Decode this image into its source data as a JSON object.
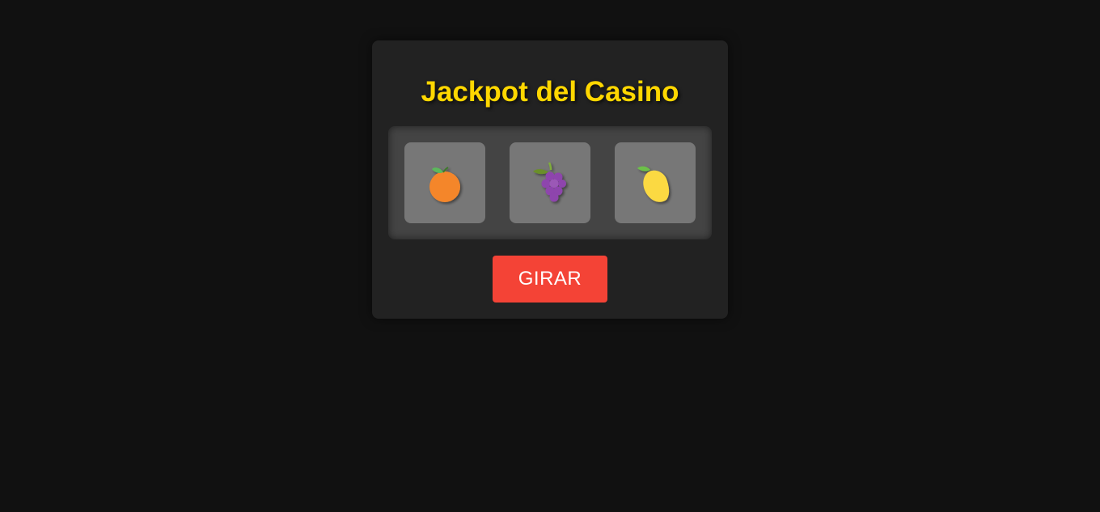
{
  "game": {
    "title": "Jackpot del Casino",
    "spin_label": "GIRAR"
  },
  "reels": [
    {
      "symbol": "orange"
    },
    {
      "symbol": "grapes"
    },
    {
      "symbol": "lemon"
    }
  ],
  "colors": {
    "page_background": "#111111",
    "card_background": "#222222",
    "reel_frame": "#444444",
    "reel_cell": "#777777",
    "title": "#ffd700",
    "spin_button": "#f44336"
  }
}
